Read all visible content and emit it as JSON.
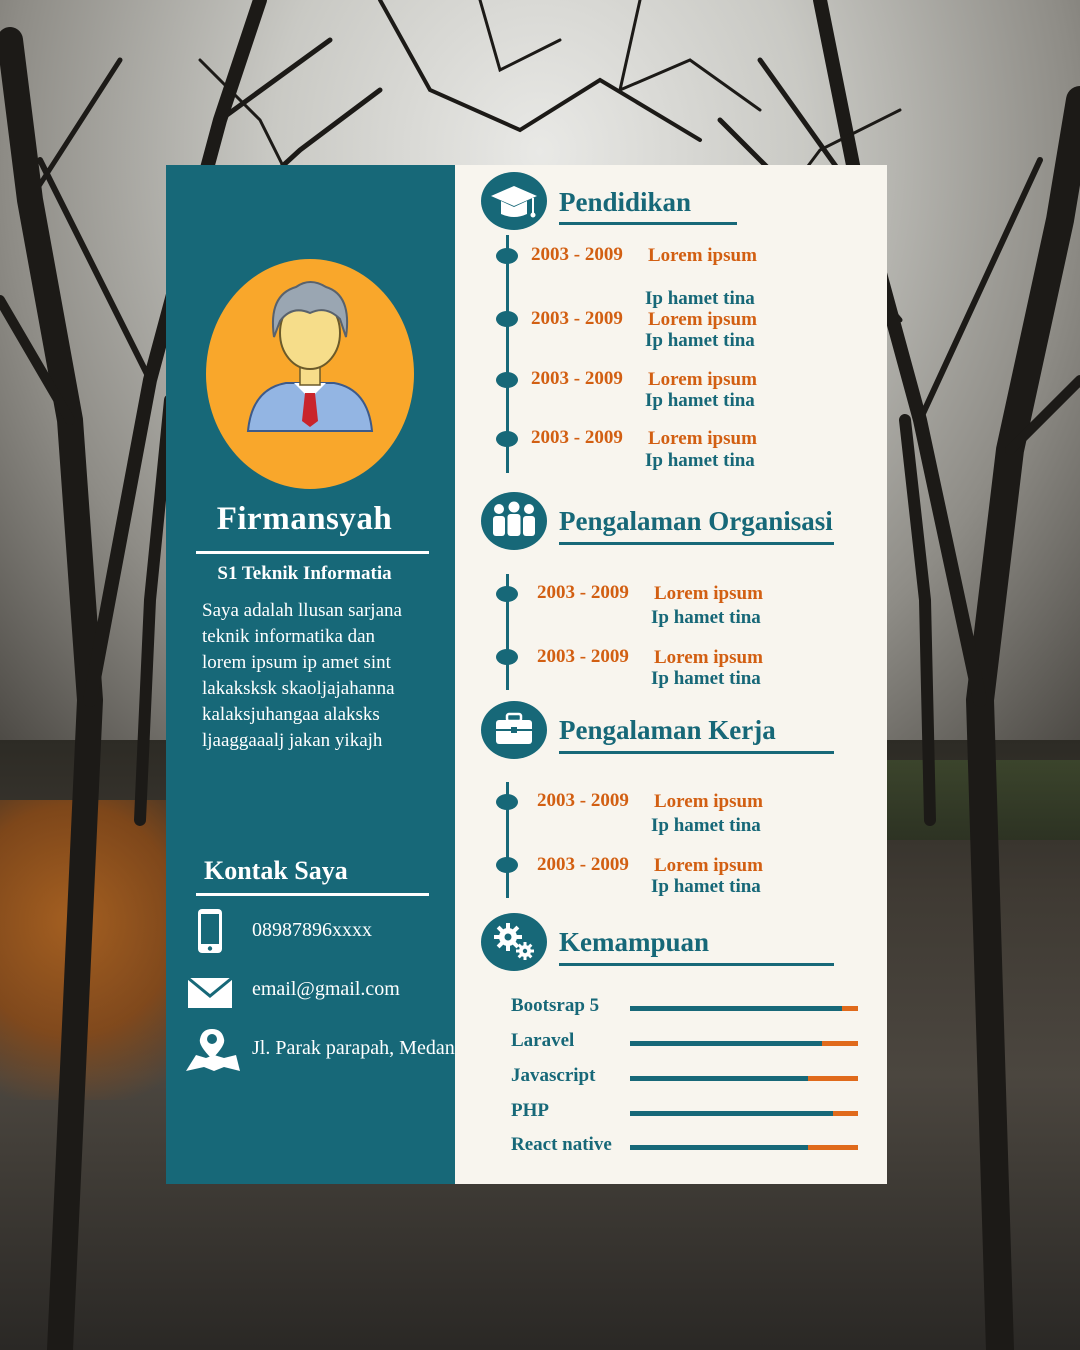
{
  "profile": {
    "name": "Firmansyah",
    "degree": "S1 Teknik Informatia",
    "bio_lines": [
      "Saya adalah llusan sarjana",
      "teknik informatika dan",
      "lorem ipsum ip amet sint",
      "lakaksksk skaoljajahanna",
      "kalaksjuhangaa alaksks",
      "ljaaggaaalj jakan yikajh"
    ]
  },
  "contact": {
    "title": "Kontak Saya",
    "phone": "08987896xxxx",
    "email": "email@gmail.com",
    "address": "Jl. Parak parapah, Medan"
  },
  "education": {
    "title": "Pendidikan",
    "items": [
      {
        "years": "2003 - 2009",
        "line1": "Lorem ipsum",
        "line2": "Ip hamet tina"
      },
      {
        "years": "2003 - 2009",
        "line1": "Lorem ipsum",
        "line2": "Ip hamet tina"
      },
      {
        "years": "2003 - 2009",
        "line1": "Lorem ipsum",
        "line2": "Ip hamet tina"
      },
      {
        "years": "2003 - 2009",
        "line1": "Lorem ipsum",
        "line2": "Ip hamet tina"
      }
    ]
  },
  "organization": {
    "title": "Pengalaman Organisasi",
    "items": [
      {
        "years": "2003 - 2009",
        "line1": "Lorem ipsum",
        "line2": "Ip hamet tina"
      },
      {
        "years": "2003 - 2009",
        "line1": "Lorem ipsum",
        "line2": "Ip hamet tina"
      }
    ]
  },
  "work": {
    "title": "Pengalaman Kerja",
    "items": [
      {
        "years": "2003 - 2009",
        "line1": "Lorem ipsum",
        "line2": "Ip hamet tina"
      },
      {
        "years": "2003 - 2009",
        "line1": "Lorem ipsum",
        "line2": "Ip hamet tina"
      }
    ]
  },
  "skills": {
    "title": "Kemampuan",
    "items": [
      {
        "name": "Bootsrap 5",
        "level": 0.93
      },
      {
        "name": "Laravel",
        "level": 0.84
      },
      {
        "name": "Javascript",
        "level": 0.78
      },
      {
        "name": "PHP",
        "level": 0.89
      },
      {
        "name": "React native",
        "level": 0.78
      }
    ]
  },
  "colors": {
    "primary": "#176878",
    "accent": "#d25f12",
    "avatar_bg": "#f9a72b",
    "paper": "#f8f5ee"
  },
  "icons": {
    "education": "graduation-cap-icon",
    "organization": "people-group-icon",
    "work": "briefcase-icon",
    "skills": "gears-icon",
    "phone": "phone-icon",
    "email": "envelope-icon",
    "address": "map-pin-icon"
  }
}
